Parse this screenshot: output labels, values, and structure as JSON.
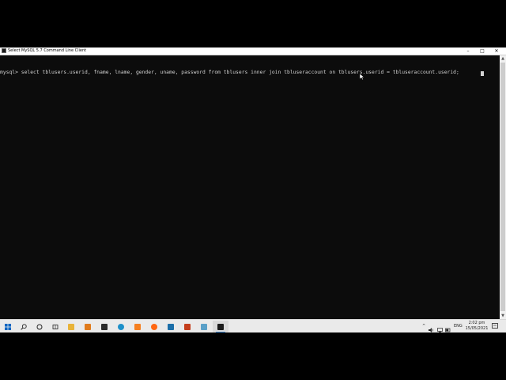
{
  "window": {
    "title": "Select MySQL 5.7 Command Line Client",
    "controls": {
      "minimize": "–",
      "maximize": "□",
      "close": "✕"
    }
  },
  "console": {
    "prompt": "mysql>",
    "command": "select tblusers.userid, fname, lname, gender, uname, password from tblusers inner join tbluseraccount on tblusers.userid = tbluseraccount.userid;"
  },
  "taskbar": {
    "items": [
      {
        "name": "start-button",
        "icon": "windows-logo-icon"
      },
      {
        "name": "search-button",
        "icon": "search-icon"
      },
      {
        "name": "cortana-button",
        "icon": "circle-icon"
      },
      {
        "name": "task-view-button",
        "icon": "task-view-icon"
      },
      {
        "name": "file-explorer-app",
        "icon": "folder-icon",
        "color": "#e8b339"
      },
      {
        "name": "sublime-app",
        "icon": "sublime-icon",
        "color": "#e07b1c"
      },
      {
        "name": "store-app",
        "icon": "shopping-bag-icon",
        "color": "#2b2b2b"
      },
      {
        "name": "edge-app",
        "icon": "edge-icon",
        "color": "#1e90c9"
      },
      {
        "name": "xampp-app",
        "icon": "xampp-icon",
        "color": "#f57f20"
      },
      {
        "name": "firefox-app",
        "icon": "firefox-icon",
        "color": "#ff6611"
      },
      {
        "name": "mysql-workbench-app",
        "icon": "dolphin-icon",
        "color": "#1c6fa9"
      },
      {
        "name": "powerpoint-app",
        "icon": "powerpoint-icon",
        "color": "#c43e1c"
      },
      {
        "name": "notepad-app",
        "icon": "notepad-icon",
        "color": "#5aa0c8"
      },
      {
        "name": "mysql-console-app",
        "icon": "console-icon",
        "color": "#1b1b1b"
      }
    ],
    "tray": {
      "chevron": "^",
      "language": "ENG",
      "time": "2:02 pm",
      "date": "15/05/2021"
    }
  }
}
